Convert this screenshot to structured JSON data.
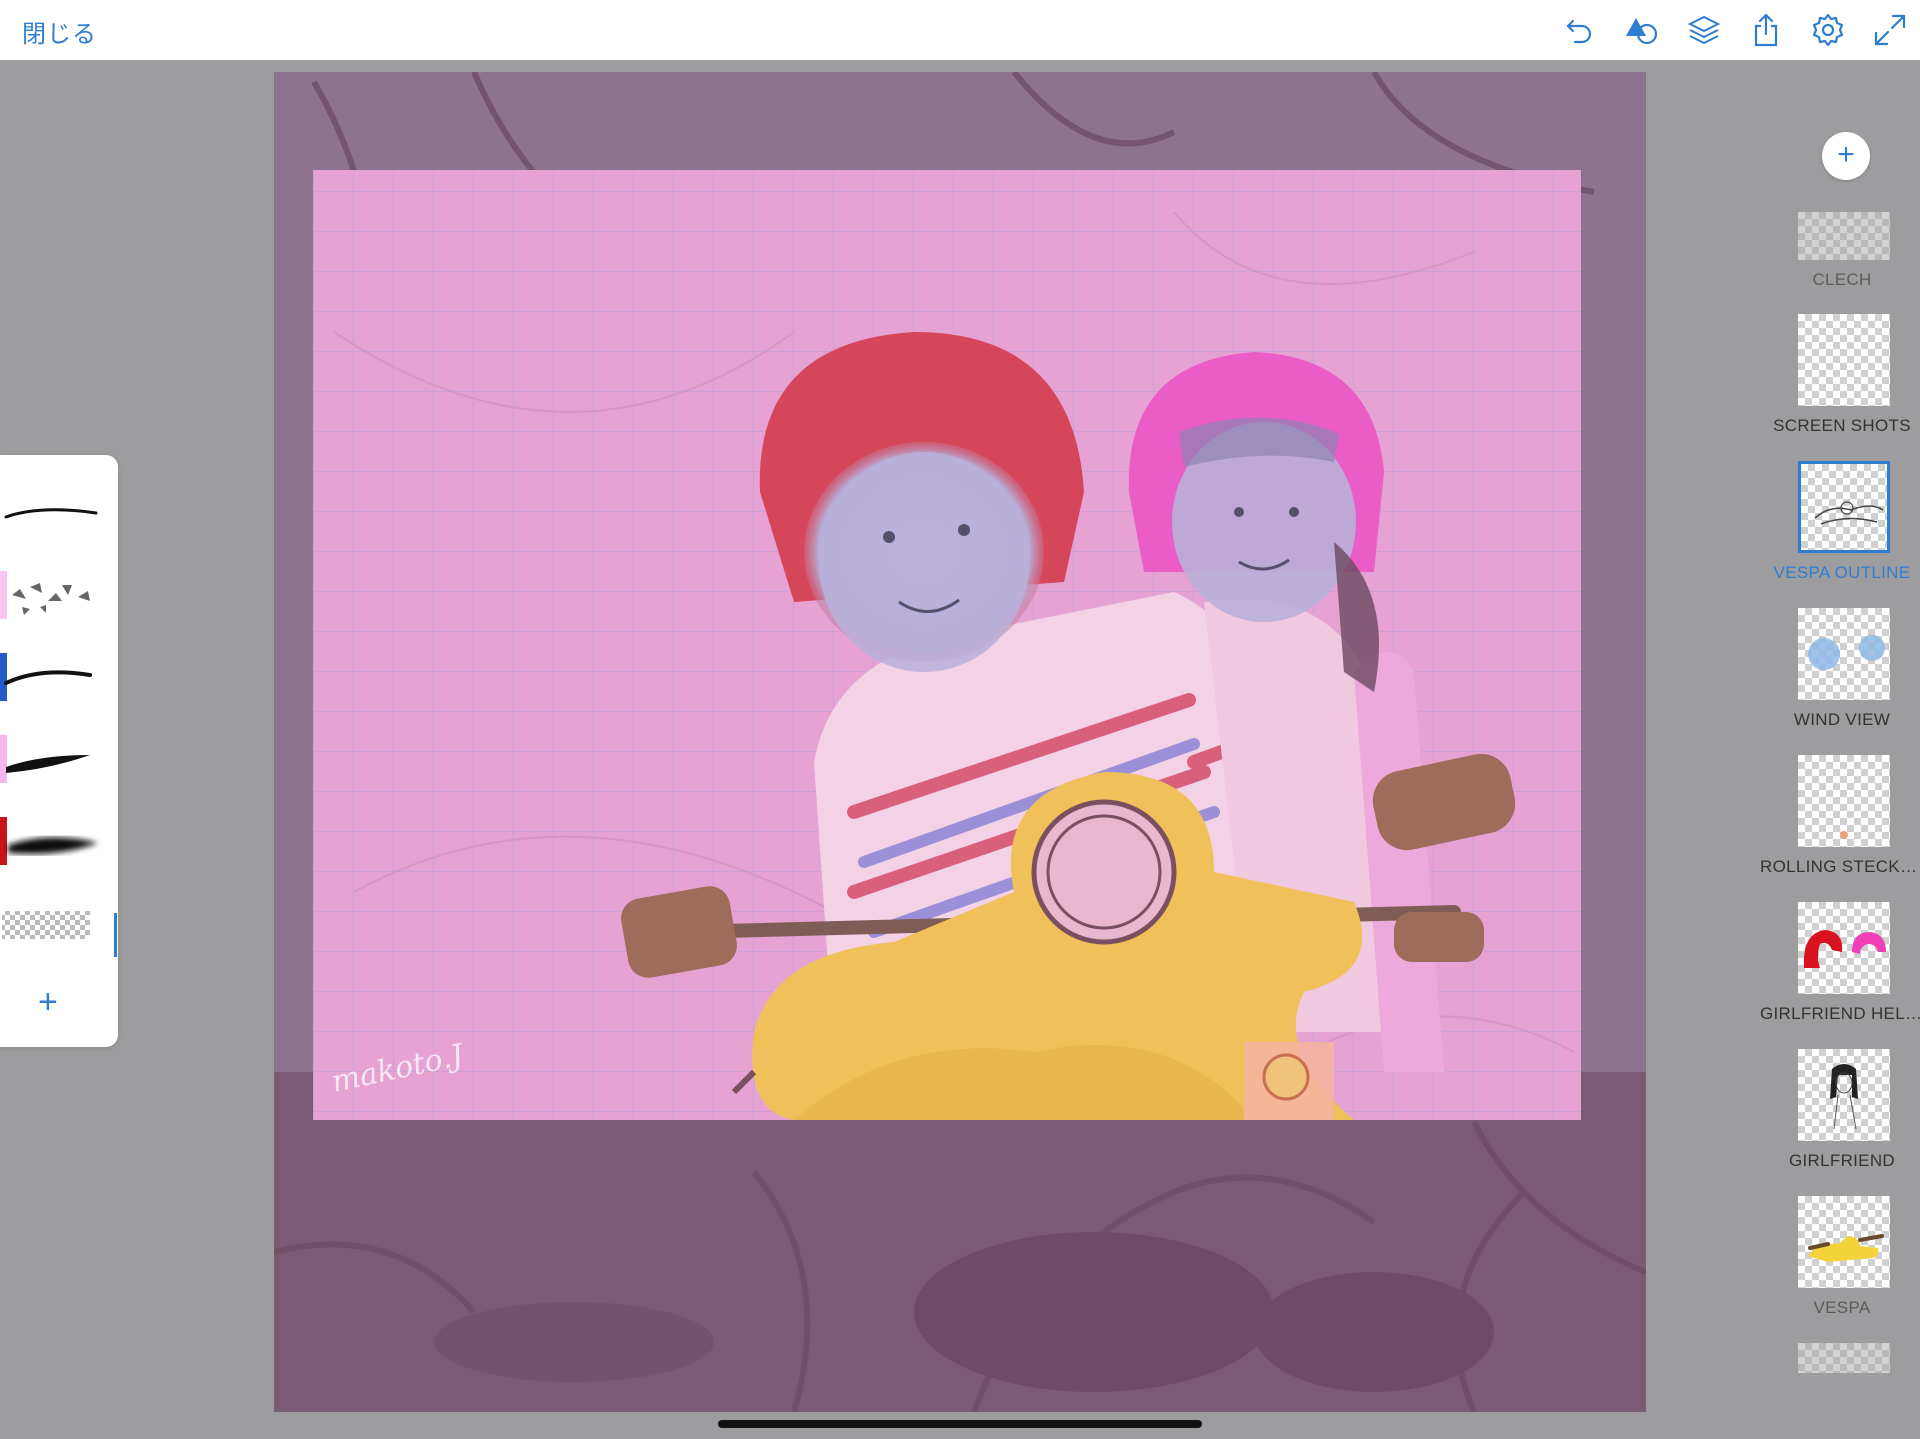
{
  "topbar": {
    "close_label": "閉じる",
    "icons": [
      "undo-icon",
      "shape-icon",
      "layers-icon",
      "share-icon",
      "settings-icon",
      "fullscreen-icon"
    ]
  },
  "canvas": {
    "signature": "makoto.J"
  },
  "brushes": {
    "items": [
      {
        "name": "brush-pen",
        "swatch": "#ffffff"
      },
      {
        "name": "brush-scatter",
        "swatch": "#f6c6ef"
      },
      {
        "name": "brush-ink",
        "swatch": "#2558c9"
      },
      {
        "name": "brush-taper",
        "swatch": "#f5b8ee"
      },
      {
        "name": "brush-soft",
        "swatch": "#c8141c"
      },
      {
        "name": "brush-eraser",
        "swatch": "#ffffff"
      }
    ],
    "add_label": "+"
  },
  "layers": {
    "add_label": "+",
    "items": [
      {
        "label": "CLECH",
        "state": "dim"
      },
      {
        "label": "SCREEN SHOTS",
        "state": "normal"
      },
      {
        "label": "VESPA OUTLINE",
        "state": "selected"
      },
      {
        "label": "WIND VIEW",
        "state": "normal"
      },
      {
        "label": "ROLLING STECKER",
        "state": "normal"
      },
      {
        "label": "GIRLFRIEND HELMET",
        "state": "normal"
      },
      {
        "label": "GIRLFRIEND",
        "state": "normal"
      },
      {
        "label": "VESPA",
        "state": "dim"
      }
    ]
  },
  "colors": {
    "accent": "#2f7dd1",
    "canvas_bg": "#7d5a76",
    "artboard": "#e59ed0",
    "helmet_red": "#d6465a",
    "helmet_pink": "#ea5cc6",
    "vespa_yellow": "#f0c15a"
  }
}
